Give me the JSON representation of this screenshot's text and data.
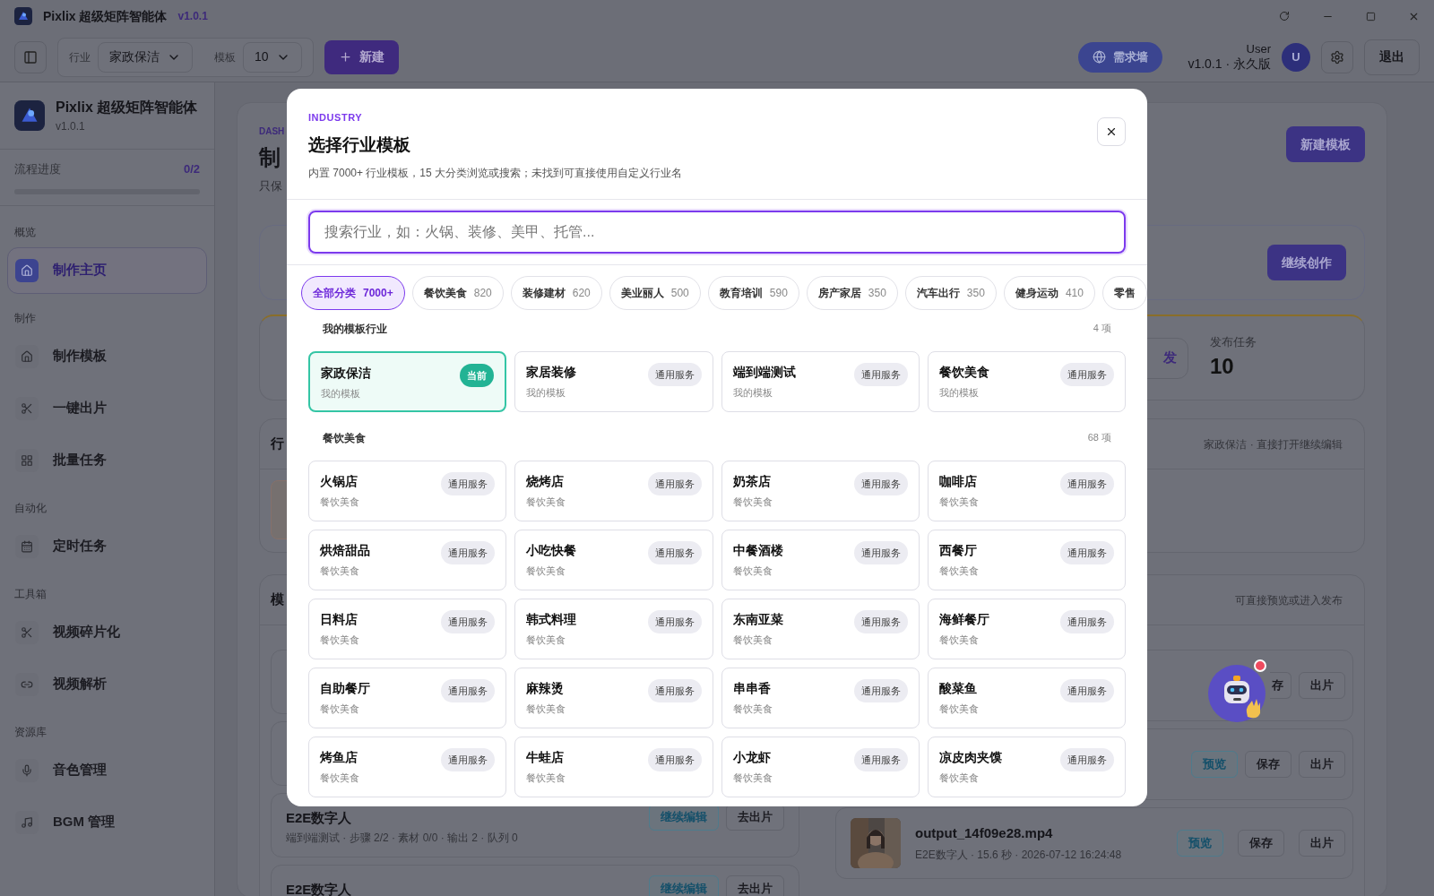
{
  "titlebar": {
    "app_name": "Pixlix 超级矩阵智能体",
    "version": "v1.0.1"
  },
  "toolbar": {
    "industry_label": "行业",
    "industry_value": "家政保洁",
    "template_label": "模板",
    "template_value": "10",
    "new_button": "新建",
    "demand_button": "需求墙",
    "user_name": "User",
    "user_plan": "v1.0.1 · 永久版",
    "avatar": "U",
    "logout": "退出"
  },
  "sidebar": {
    "app_name": "Pixlix 超级矩阵智能体",
    "version": "v1.0.1",
    "progress_label": "流程进度",
    "progress_value": "0/2",
    "progress": {
      "level": 0
    },
    "sections": [
      {
        "title": "概览",
        "items": [
          {
            "label": "制作主页",
            "selected": true
          }
        ]
      },
      {
        "title": "制作",
        "items": [
          {
            "label": "制作模板",
            "selected": false
          },
          {
            "label": "一键出片",
            "selected": false
          },
          {
            "label": "批量任务",
            "selected": false
          }
        ]
      },
      {
        "title": "自动化",
        "items": [
          {
            "label": "定时任务",
            "selected": false
          }
        ]
      },
      {
        "title": "工具箱",
        "items": [
          {
            "label": "视频碎片化",
            "selected": false
          },
          {
            "label": "视频解析",
            "selected": false
          }
        ]
      },
      {
        "title": "资源库",
        "items": [
          {
            "label": "音色管理",
            "selected": false
          },
          {
            "label": "BGM 管理",
            "selected": false
          }
        ]
      }
    ]
  },
  "background": {
    "eyebrow": "DASH",
    "title": "制",
    "subtitle": "只保",
    "new_template": "新建模板",
    "continue": "继续创作",
    "publish_fragment": "发",
    "publish_label": "发布任务",
    "publish_value": "10",
    "card_a_title": "行",
    "card_a_note": "家政保洁 · 直接打开继续编辑",
    "card_b_title": "模",
    "card_b_note": "可直接预览或进入发布",
    "right_rows": [
      {
        "buttons": [
          "存",
          "出片"
        ]
      },
      {
        "buttons": [
          "预览",
          "保存",
          "出片"
        ]
      }
    ],
    "output": {
      "file": "output_14f09e28.mp4",
      "meta": "E2E数字人 · 15.6 秒 · 2026-07-12 16:24:48",
      "buttons": [
        "预览",
        "保存",
        "出片"
      ]
    },
    "left_rows": [
      {
        "title": "E2E数字人",
        "meta": "端到端测试 · 步骤 2/2 · 素材 0/0 · 输出 2 · 队列 0",
        "buttons": [
          "继续编辑",
          "去出片"
        ]
      },
      {
        "title": "E2E数字人",
        "buttons": [
          "继续编辑",
          "去出片"
        ]
      }
    ]
  },
  "modal": {
    "eyebrow": "INDUSTRY",
    "title": "选择行业模板",
    "description": "内置 7000+ 行业模板，15 大分类浏览或搜索；未找到可直接使用自定义行业名",
    "search": {
      "placeholder": "搜索行业，如：火锅、装修、美甲、托管..."
    },
    "categories": [
      {
        "label": "全部分类",
        "count": "7000+",
        "selected": true
      },
      {
        "label": "餐饮美食",
        "count": "820",
        "selected": false
      },
      {
        "label": "装修建材",
        "count": "620",
        "selected": false
      },
      {
        "label": "美业丽人",
        "count": "500",
        "selected": false
      },
      {
        "label": "教育培训",
        "count": "590",
        "selected": false
      },
      {
        "label": "房产家居",
        "count": "350",
        "selected": false
      },
      {
        "label": "汽车出行",
        "count": "350",
        "selected": false
      },
      {
        "label": "健身运动",
        "count": "410",
        "selected": false
      },
      {
        "label": "零售",
        "selected": false
      }
    ],
    "groups": [
      {
        "title": "我的模板行业",
        "count": "4 项",
        "items": [
          {
            "name": "家政保洁",
            "sub": "我的模板",
            "badge": "当前",
            "selected": true
          },
          {
            "name": "家居装修",
            "sub": "我的模板",
            "badge": "通用服务",
            "selected": false
          },
          {
            "name": "端到端测试",
            "sub": "我的模板",
            "badge": "通用服务",
            "selected": false
          },
          {
            "name": "餐饮美食",
            "sub": "我的模板",
            "badge": "通用服务",
            "selected": false
          }
        ]
      },
      {
        "title": "餐饮美食",
        "count": "68 项",
        "items": [
          {
            "name": "火锅店",
            "sub": "餐饮美食",
            "badge": "通用服务",
            "selected": false
          },
          {
            "name": "烧烤店",
            "sub": "餐饮美食",
            "badge": "通用服务",
            "selected": false
          },
          {
            "name": "奶茶店",
            "sub": "餐饮美食",
            "badge": "通用服务",
            "selected": false
          },
          {
            "name": "咖啡店",
            "sub": "餐饮美食",
            "badge": "通用服务",
            "selected": false
          },
          {
            "name": "烘焙甜品",
            "sub": "餐饮美食",
            "badge": "通用服务",
            "selected": false
          },
          {
            "name": "小吃快餐",
            "sub": "餐饮美食",
            "badge": "通用服务",
            "selected": false
          },
          {
            "name": "中餐酒楼",
            "sub": "餐饮美食",
            "badge": "通用服务",
            "selected": false
          },
          {
            "name": "西餐厅",
            "sub": "餐饮美食",
            "badge": "通用服务",
            "selected": false
          },
          {
            "name": "日料店",
            "sub": "餐饮美食",
            "badge": "通用服务",
            "selected": false
          },
          {
            "name": "韩式料理",
            "sub": "餐饮美食",
            "badge": "通用服务",
            "selected": false
          },
          {
            "name": "东南亚菜",
            "sub": "餐饮美食",
            "badge": "通用服务",
            "selected": false
          },
          {
            "name": "海鲜餐厅",
            "sub": "餐饮美食",
            "badge": "通用服务",
            "selected": false
          },
          {
            "name": "自助餐厅",
            "sub": "餐饮美食",
            "badge": "通用服务",
            "selected": false
          },
          {
            "name": "麻辣烫",
            "sub": "餐饮美食",
            "badge": "通用服务",
            "selected": false
          },
          {
            "name": "串串香",
            "sub": "餐饮美食",
            "badge": "通用服务",
            "selected": false
          },
          {
            "name": "酸菜鱼",
            "sub": "餐饮美食",
            "badge": "通用服务",
            "selected": false
          },
          {
            "name": "烤鱼店",
            "sub": "餐饮美食",
            "badge": "通用服务",
            "selected": false
          },
          {
            "name": "牛蛙店",
            "sub": "餐饮美食",
            "badge": "通用服务",
            "selected": false
          },
          {
            "name": "小龙虾",
            "sub": "餐饮美食",
            "badge": "通用服务",
            "selected": false
          },
          {
            "name": "凉皮肉夹馍",
            "sub": "餐饮美食",
            "badge": "通用服务",
            "selected": false
          }
        ]
      }
    ]
  }
}
